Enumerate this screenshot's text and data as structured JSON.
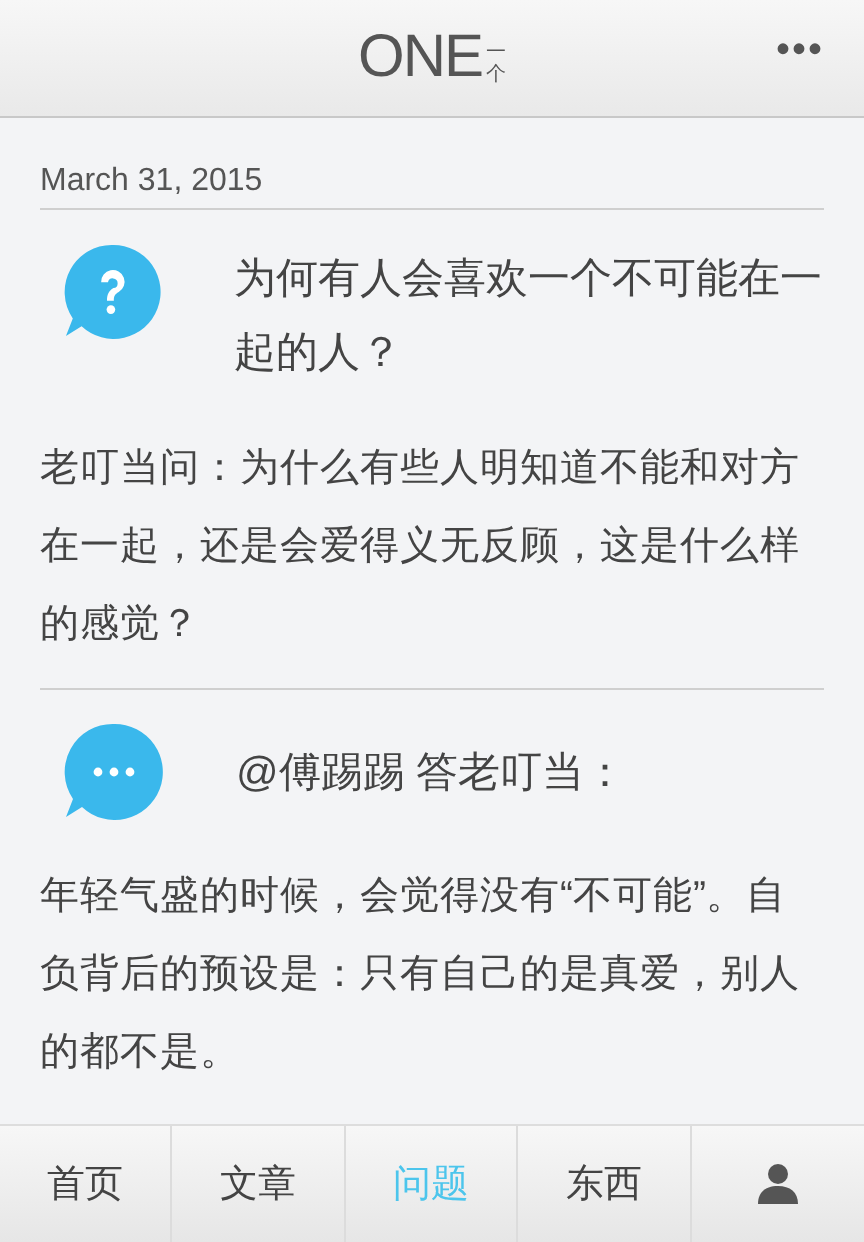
{
  "header": {
    "logo_text": "ONE",
    "logo_mark": "一个",
    "menu": "•••"
  },
  "date": "March 31, 2015",
  "question": {
    "title": "为何有人会喜欢一个不可能在一起的人？",
    "body": "老叮当问：为什么有些人明知道不能和对方在一起，还是会爱得义无反顾，这是什么样的感觉？"
  },
  "answer": {
    "author": "@傅踢踢 答老叮当：",
    "body": "年轻气盛的时候，会觉得没有“不可能”。自负背后的预设是：只有自己的是真爱，别人的都不是。"
  },
  "tabs": [
    {
      "kind": "text",
      "label": "首页",
      "selected": false
    },
    {
      "kind": "text",
      "label": "文章",
      "selected": false
    },
    {
      "kind": "text",
      "label": "问题",
      "selected": true
    },
    {
      "kind": "text",
      "label": "东西",
      "selected": false
    },
    {
      "kind": "person",
      "selected": false
    }
  ]
}
